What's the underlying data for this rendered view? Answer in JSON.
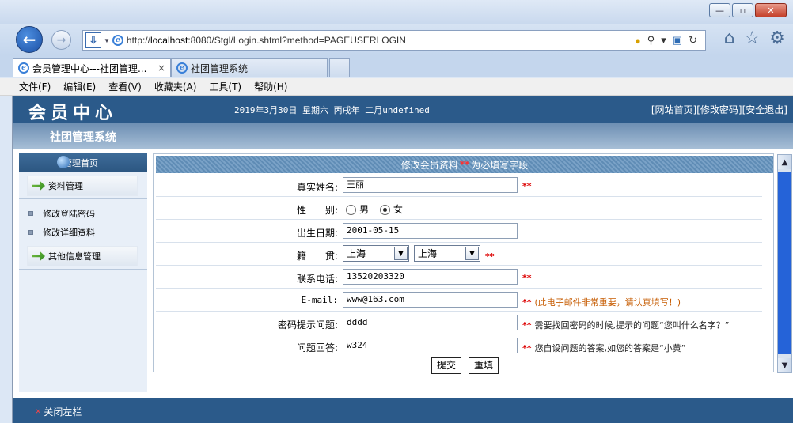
{
  "browser": {
    "url_prefix": "http://",
    "url_host": "localhost",
    "url_rest": ":8080/Stgl/Login.shtml?method=PAGEUSERLOGIN",
    "tabs": [
      {
        "label": "会员管理中心---社团管理...",
        "close": "×"
      },
      {
        "label": "社团管理系统"
      }
    ],
    "menu": [
      "文件(F)",
      "编辑(E)",
      "查看(V)",
      "收藏夹(A)",
      "工具(T)",
      "帮助(H)"
    ]
  },
  "header": {
    "logo": "会员中心",
    "date_text": "2019年3月30日 星期六 丙戌年 二月undefined",
    "links": [
      "[网站首页]",
      "[修改密码]",
      "[安全退出]"
    ],
    "system_title": "社团管理系统"
  },
  "sidebar": {
    "head": "管理首页",
    "groups": [
      {
        "label": "资料管理",
        "items": [
          "修改登陆密码",
          "修改详细资料"
        ]
      },
      {
        "label": "其他信息管理"
      }
    ]
  },
  "form": {
    "title": "修改会员资料",
    "req_mark": "**",
    "title_suffix": "为必填写字段",
    "name": {
      "label": "真实姓名:",
      "value": "王丽"
    },
    "gender": {
      "label": "性　　别:",
      "options": [
        "男",
        "女"
      ],
      "selected": "女"
    },
    "birth": {
      "label": "出生日期:",
      "value": "2001-05-15"
    },
    "native": {
      "label": "籍　　贯:",
      "province": "上海",
      "city": "上海"
    },
    "phone": {
      "label": "联系电话:",
      "value": "13520203320"
    },
    "email": {
      "label": "E-mail:",
      "value": "www@163.com",
      "note": "(此电子邮件非常重要，请认真填写！)"
    },
    "question": {
      "label": "密码提示问题:",
      "value": "dddd",
      "note": "需要找回密码的时候,提示的问题“您叫什么名字？”"
    },
    "answer": {
      "label": "问题回答:",
      "value": "w324",
      "note": "您自设问题的答案,如您的答案是“小黄”"
    },
    "submit": "提交",
    "reset": "重填"
  },
  "footer": {
    "close_icon": "×",
    "close_label": "关闭左栏"
  },
  "colors": {
    "header_blue": "#2b5a8a",
    "scroll_thumb": "#2563d8",
    "required_red": "#dd0000"
  }
}
